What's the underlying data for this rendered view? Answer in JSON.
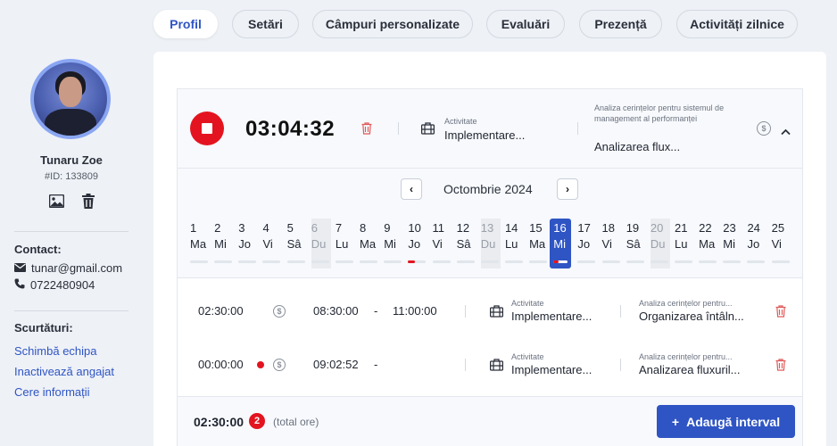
{
  "tabs": [
    {
      "label": "Profil",
      "active": true
    },
    {
      "label": "Setări",
      "active": false
    },
    {
      "label": "Câmpuri personalizate",
      "active": false
    },
    {
      "label": "Evaluări",
      "active": false
    },
    {
      "label": "Prezență",
      "active": false
    },
    {
      "label": "Activități zilnice",
      "active": false
    }
  ],
  "profile": {
    "name": "Tunaru Zoe",
    "id_label": "#ID: 133809",
    "icons": [
      "image-icon",
      "trash-icon"
    ]
  },
  "contact": {
    "title": "Contact:",
    "email": "tunar@gmail.com",
    "phone": "0722480904"
  },
  "shortcuts": {
    "title": "Scurtături:",
    "items": [
      "Schimbă echipa",
      "Inactivează angajat",
      "Cere informații"
    ]
  },
  "timer": {
    "elapsed": "03:04:32",
    "activity_label": "Activitate",
    "activity_value": "Implementare...",
    "task_label": "Analiza cerințelor pentru sistemul de management al performanței",
    "task_value": "Analizarea flux..."
  },
  "calendar": {
    "month": "Octombrie 2024",
    "prev": "‹",
    "next": "›",
    "days": [
      {
        "n": "1",
        "w": "Ma"
      },
      {
        "n": "2",
        "w": "Mi"
      },
      {
        "n": "3",
        "w": "Jo"
      },
      {
        "n": "4",
        "w": "Vi"
      },
      {
        "n": "5",
        "w": "Sâ"
      },
      {
        "n": "6",
        "w": "Du"
      },
      {
        "n": "7",
        "w": "Lu"
      },
      {
        "n": "8",
        "w": "Ma"
      },
      {
        "n": "9",
        "w": "Mi"
      },
      {
        "n": "10",
        "w": "Jo"
      },
      {
        "n": "11",
        "w": "Vi"
      },
      {
        "n": "12",
        "w": "Sâ"
      },
      {
        "n": "13",
        "w": "Du"
      },
      {
        "n": "14",
        "w": "Lu"
      },
      {
        "n": "15",
        "w": "Ma"
      },
      {
        "n": "16",
        "w": "Mi"
      },
      {
        "n": "17",
        "w": "Jo"
      },
      {
        "n": "18",
        "w": "Vi"
      },
      {
        "n": "19",
        "w": "Sâ"
      },
      {
        "n": "20",
        "w": "Du"
      },
      {
        "n": "21",
        "w": "Lu"
      },
      {
        "n": "22",
        "w": "Ma"
      },
      {
        "n": "23",
        "w": "Mi"
      },
      {
        "n": "24",
        "w": "Jo"
      },
      {
        "n": "25",
        "w": "Vi"
      }
    ],
    "selected_day": "16"
  },
  "entries": [
    {
      "duration": "02:30:00",
      "start": "08:30:00",
      "dash": "-",
      "end": "11:00:00",
      "activity_label": "Activitate",
      "activity_value": "Implementare...",
      "task_label": "Analiza cerințelor pentru...",
      "task_value": "Organizarea întâln..."
    },
    {
      "duration": "00:00:00",
      "start": "09:02:52",
      "dash": "-",
      "end": "",
      "activity_label": "Activitate",
      "activity_value": "Implementare...",
      "task_label": "Analiza cerințelor pentru...",
      "task_value": "Analizarea fluxuril..."
    }
  ],
  "footer": {
    "total": "02:30:00",
    "count": "2",
    "total_label": "(total ore)",
    "add_button": "Adaugă interval",
    "add_icon": "+"
  },
  "colors": {
    "accent": "#2f55c4",
    "danger": "#e3141f",
    "background": "#eef1f6"
  }
}
